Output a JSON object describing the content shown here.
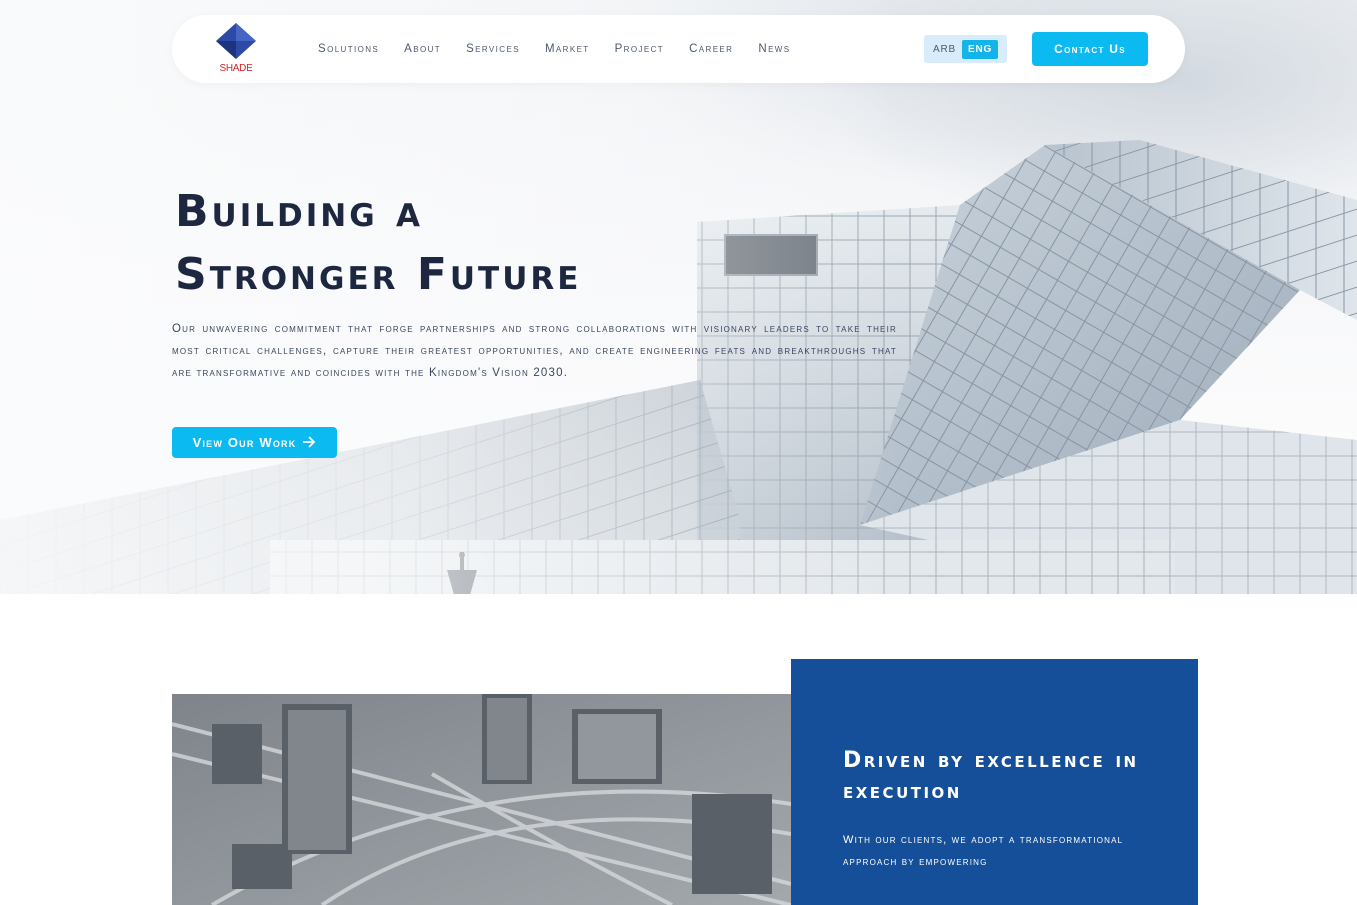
{
  "logo": {
    "text": "SHADE"
  },
  "nav": {
    "links": [
      "Solutions",
      "About",
      "Services",
      "Market",
      "Project",
      "Career",
      "News"
    ],
    "lang_arb": "ARB",
    "lang_eng": "ENG",
    "contact_label": "Contact Us"
  },
  "hero": {
    "title_line1": "Building a",
    "title_line2": "Stronger Future",
    "description": "Our unwavering commitment that forge partnerships and strong collaborations with visionary leaders to take their most critical challenges, capture their greatest opportunities, and create engineering feats and breakthroughs that are transformative and coincides with the Kingdom's Vision 2030.",
    "cta_label": "View Our Work",
    "cta_icon": "arrow-right-icon"
  },
  "excellence": {
    "title": "Driven by excellence in execution",
    "text": "With our clients, we adopt a transformational approach by empowering"
  },
  "colors": {
    "accent": "#0bbaf0",
    "card_blue": "#154f99",
    "heading": "#1d2740",
    "logo_blue": "#2d4aa6",
    "logo_red": "#d2232a"
  }
}
